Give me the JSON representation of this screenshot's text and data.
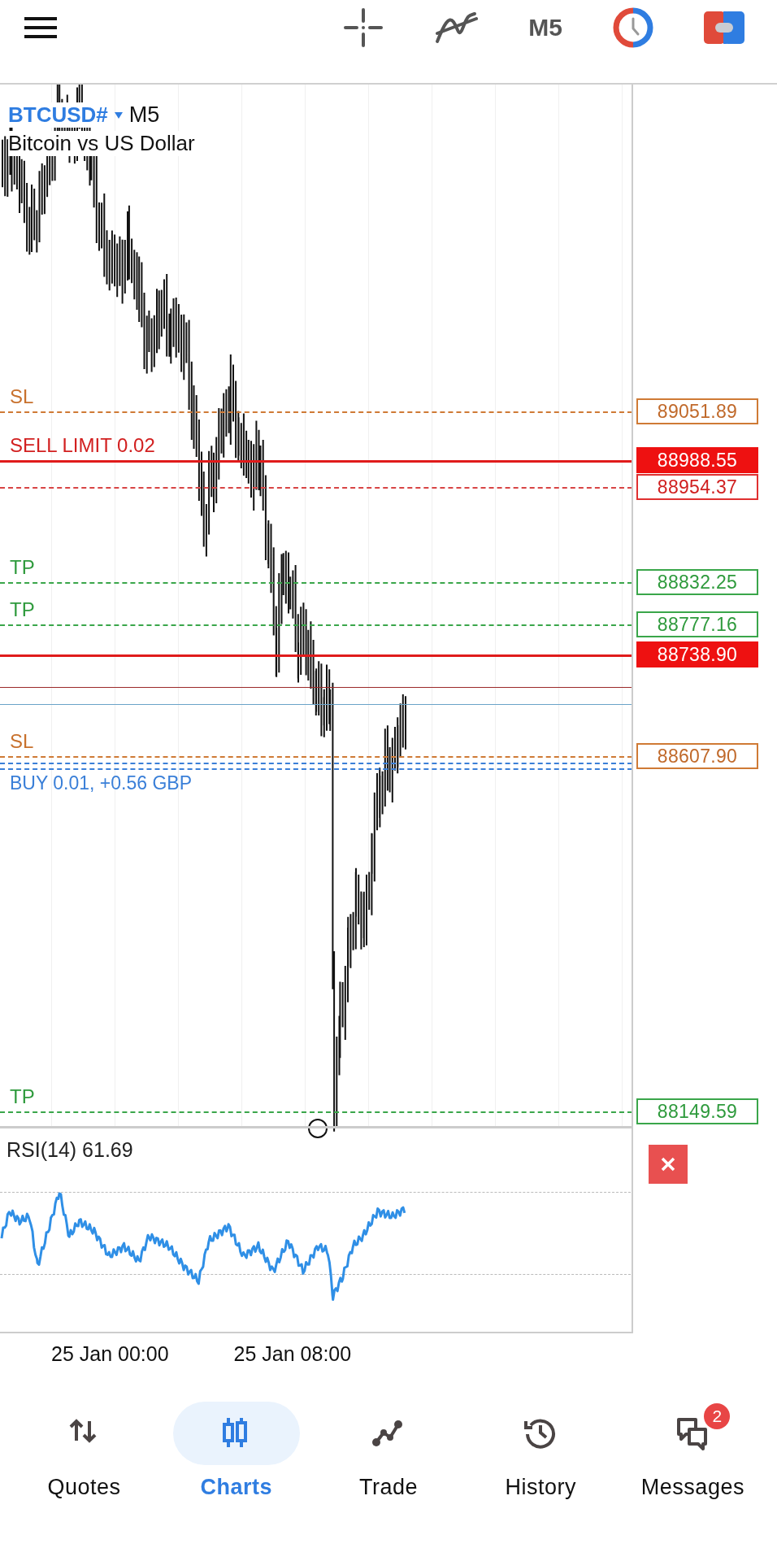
{
  "toolbar": {
    "timeframe": "M5"
  },
  "chart": {
    "symbol": "BTCUSD#",
    "timeframe": "M5",
    "description": "Bitcoin vs US Dollar",
    "levels": [
      {
        "kind": "sl_order",
        "label": "SL",
        "price": "89051.89"
      },
      {
        "kind": "sell_limit",
        "label": "SELL LIMIT 0.02",
        "price": "88988.55"
      },
      {
        "kind": "order_price",
        "price": "88954.37"
      },
      {
        "kind": "tp",
        "label": "TP",
        "price": "88832.25"
      },
      {
        "kind": "tp",
        "label": "TP",
        "price": "88777.16"
      },
      {
        "kind": "ask",
        "price": "88738.90"
      },
      {
        "kind": "sl",
        "label": "SL",
        "price": "88607.90"
      },
      {
        "kind": "tp_order",
        "label": "TP",
        "price": "88149.59"
      }
    ],
    "position": {
      "label": "BUY 0.01, +0.56 GBP"
    }
  },
  "indicator": {
    "label": "RSI(14) 61.69"
  },
  "time_axis": [
    "25 Jan 00:00",
    "25 Jan 08:00"
  ],
  "nav": [
    {
      "label": "Quotes",
      "selected": false
    },
    {
      "label": "Charts",
      "selected": true
    },
    {
      "label": "Trade",
      "selected": false
    },
    {
      "label": "History",
      "selected": false
    },
    {
      "label": "Messages",
      "selected": false,
      "badge": "2"
    }
  ]
}
